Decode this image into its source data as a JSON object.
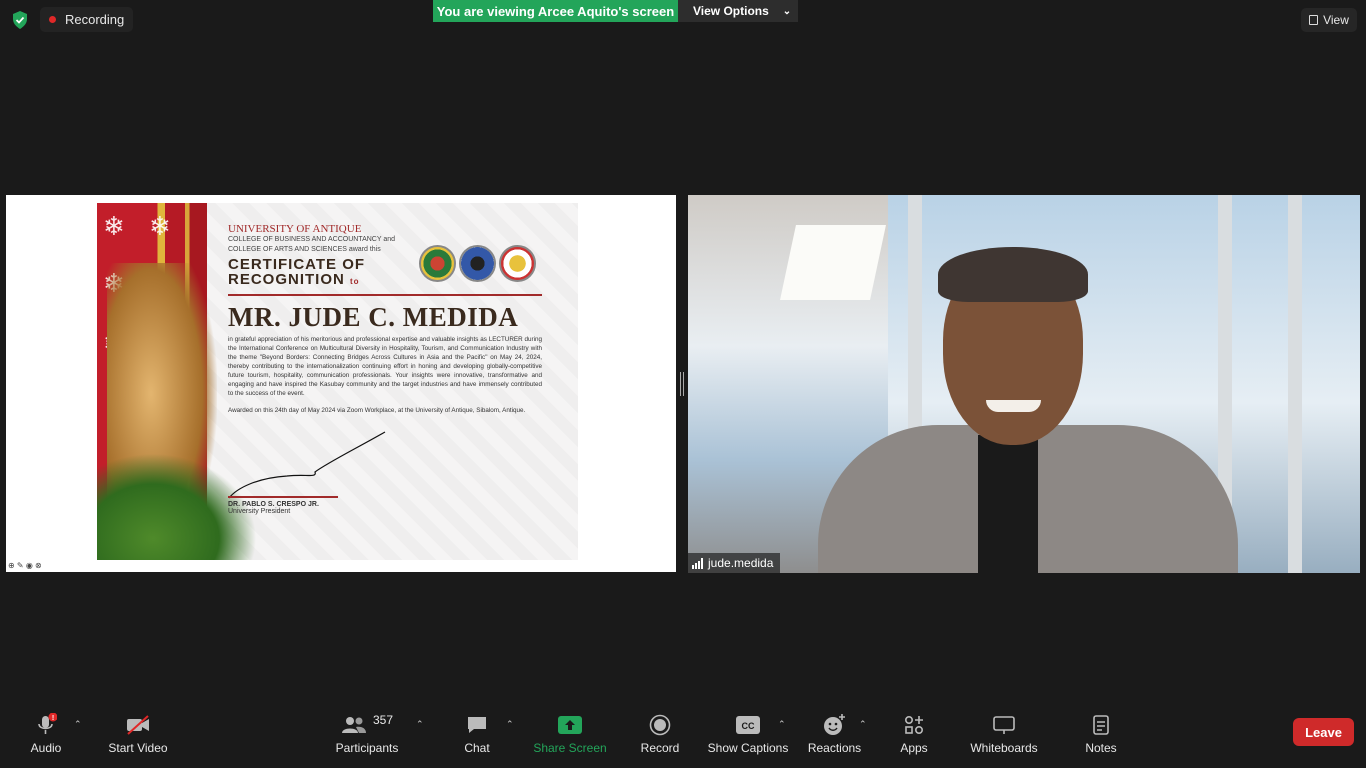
{
  "topbar": {
    "recording_label": "Recording",
    "viewing_banner": "You are viewing Arcee Aquito's screen",
    "view_options_label": "View Options",
    "view_label": "View"
  },
  "certificate": {
    "university": "UNIVERSITY OF ANTIQUE",
    "college_line1": "COLLEGE OF BUSINESS AND ACCOUNTANCY and",
    "college_line2": "COLLEGE OF ARTS AND SCIENCES award this",
    "title_line1": "CERTIFICATE OF",
    "title_line2": "RECOGNITION",
    "title_to": "to",
    "recipient": "MR. JUDE C. MEDIDA",
    "body": "in grateful appreciation of his meritorious and professional expertise and valuable insights as LECTURER during the International Conference on Multicultural Diversity in Hospitality, Tourism, and Communication Industry with the theme \"Beyond Borders: Connecting Bridges Across Cultures in Asia and the Pacific\" on May 24, 2024, thereby contributing to the internationalization continuing effort in honing and developing globally-competitive future tourism, hospitality, communication professionals. Your insights were innovative, transformative and engaging and have inspired the Kasubay community and the target industries and have immensely contributed to the success of the event.",
    "awarded": "Awarded on this 24th day of May 2024 via Zoom Workplace, at the University of Antique, Sibalom, Antique.",
    "signer_name": "DR. PABLO S. CRESPO JR.",
    "signer_title": "University President"
  },
  "participant_video": {
    "name": "jude.medida"
  },
  "toolbar": {
    "audio_label": "Audio",
    "start_video_label": "Start Video",
    "participants_label": "Participants",
    "participants_count": "357",
    "chat_label": "Chat",
    "share_screen_label": "Share Screen",
    "record_label": "Record",
    "show_captions_label": "Show Captions",
    "reactions_label": "Reactions",
    "apps_label": "Apps",
    "whiteboards_label": "Whiteboards",
    "notes_label": "Notes",
    "leave_label": "Leave"
  },
  "colors": {
    "background": "#1a1a1a",
    "share_green": "#23a55a",
    "leave_red": "#cf2a2a",
    "recording_red": "#e02828"
  }
}
